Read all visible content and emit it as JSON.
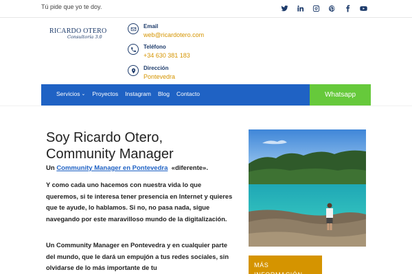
{
  "topbar": {
    "tagline": "Tú pide que yo te doy.",
    "socials": [
      "twitter-icon",
      "linkedin-icon",
      "instagram-icon",
      "pinterest-icon",
      "facebook-icon",
      "youtube-icon"
    ]
  },
  "logo": {
    "main": "RICARDO OTERO",
    "sub": "Consultoría 3.0"
  },
  "contact": {
    "email": {
      "label": "Email",
      "value": "web@ricardotero.com"
    },
    "phone": {
      "label": "Teléfono",
      "value": "+34 630 381 183"
    },
    "address": {
      "label": "Dirección",
      "value": "Pontevedra"
    }
  },
  "nav": {
    "items": [
      {
        "label": "Servicios",
        "has_dropdown": true
      },
      {
        "label": "Proyectos"
      },
      {
        "label": "Instagram"
      },
      {
        "label": "Blog"
      },
      {
        "label": "Contacto"
      }
    ],
    "whatsapp": "Whatsapp"
  },
  "hero": {
    "title_line1": "Soy Ricardo Otero,",
    "title_line2": "Community Manager",
    "sub_prefix": "Un",
    "sub_link": "Community Manager en Pontevedra",
    "sub_suffix": "«diferente».",
    "para1": "Y como cada uno hacemos con nuestra vida lo que queremos, si te interesa tener presencia en Internet y quieres que te ayude, lo hablamos. Si no, no pasa nada, sigue navegando por este maravilloso mundo de la digitalización.",
    "para2": "Un Community Manager en Pontevedra y en cualquier parte del mundo, que le dará un empujón a tus redes sociales, sin olvidarse de lo más importante de tu"
  },
  "more_button": "MÁS INFORMACIÓN",
  "colors": {
    "brand_blue": "#1f62c4",
    "accent_orange": "#d59400",
    "whatsapp_green": "#66c93b",
    "navy": "#1d3b6b"
  }
}
